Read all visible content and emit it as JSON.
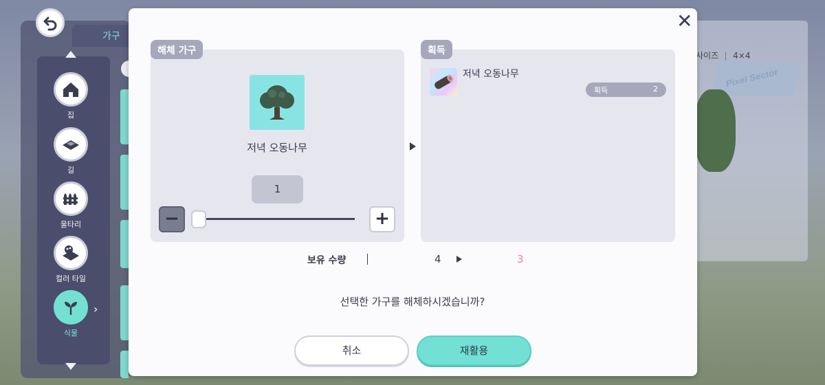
{
  "background": {
    "size_label": "사이즈",
    "size_value": "4×4",
    "sign_text": "Pixel Sector"
  },
  "sidebar": {
    "tab_label": "가구",
    "categories": [
      {
        "label": "집",
        "icon": "house-icon"
      },
      {
        "label": "길",
        "icon": "path-tile-icon"
      },
      {
        "label": "울타리",
        "icon": "fence-icon"
      },
      {
        "label": "컬러 타일",
        "icon": "palette-tile-icon"
      },
      {
        "label": "식물",
        "icon": "sprout-icon",
        "active": true
      }
    ]
  },
  "dialog": {
    "close_icon": "close-icon",
    "left_panel": {
      "tag": "해체 가구",
      "item_name": "저녁 오동나무",
      "quantity": "1",
      "minus_label": "−",
      "plus_label": "+",
      "slider_fraction": 0.0
    },
    "right_panel": {
      "tag": "획득",
      "reward_name": "저녁 오동나무",
      "reward_badge_label": "획득",
      "reward_badge_count": "2"
    },
    "owned": {
      "label": "보유 수량",
      "before": "4",
      "after": "3"
    },
    "question": "선택한 가구를 해체하시겠습니까?",
    "cancel_label": "취소",
    "confirm_label": "재활용"
  },
  "colors": {
    "accent": "#72e0d5",
    "after_count": "#f07ba2",
    "tag_bg": "#a6a7bb"
  }
}
